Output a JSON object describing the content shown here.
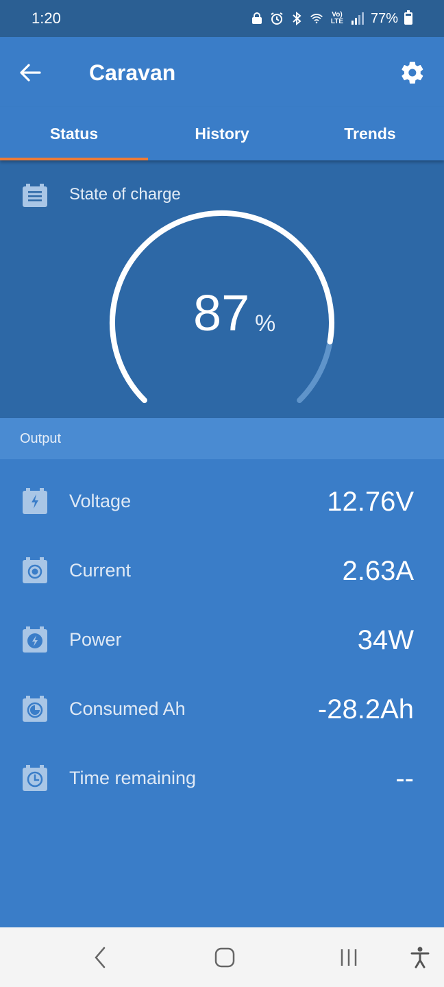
{
  "status_bar": {
    "time": "1:20",
    "lte_label": "Vo) LTE",
    "battery_percent": "77%",
    "battery_level": 0.77
  },
  "app_bar": {
    "title": "Caravan"
  },
  "tabs": [
    {
      "label": "Status",
      "active": true
    },
    {
      "label": "History",
      "active": false
    },
    {
      "label": "Trends",
      "active": false
    }
  ],
  "state_of_charge": {
    "label": "State of charge",
    "value": "87",
    "unit": "%",
    "fraction": 0.87
  },
  "output": {
    "header": "Output",
    "rows": [
      {
        "label": "Voltage",
        "value": "12.76V",
        "icon": "bolt-icon"
      },
      {
        "label": "Current",
        "value": "2.63A",
        "icon": "current-icon"
      },
      {
        "label": "Power",
        "value": "34W",
        "icon": "power-icon"
      },
      {
        "label": "Consumed Ah",
        "value": "-28.2Ah",
        "icon": "consumed-icon"
      },
      {
        "label": "Time remaining",
        "value": "--",
        "icon": "clock-icon"
      }
    ]
  },
  "colors": {
    "status_bar": "#2b5f93",
    "app_bar": "#3a7dc8",
    "gauge_panel": "#2d68a6",
    "section_header": "#4a8bd2",
    "tab_indicator": "#f07b35",
    "nav_bar": "#f4f4f4"
  }
}
